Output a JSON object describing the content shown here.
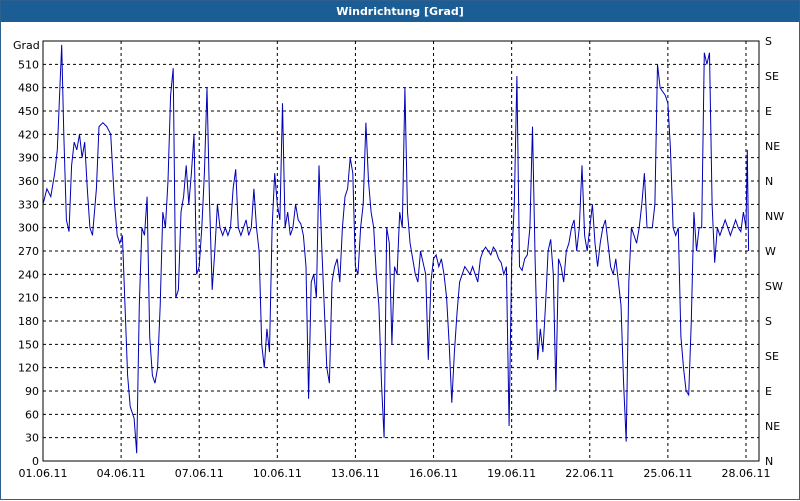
{
  "window": {
    "title": "Windrichtung [Grad]"
  },
  "colors": {
    "titlebar": "#1b5e96",
    "line": "#0000b4",
    "grid": "#000000"
  },
  "chart_data": {
    "type": "line",
    "title": "Windrichtung [Grad]",
    "ylabel": "Grad",
    "ylim": [
      0,
      540
    ],
    "yticks": [
      0,
      30,
      60,
      90,
      120,
      150,
      180,
      210,
      240,
      270,
      300,
      330,
      360,
      390,
      420,
      450,
      480,
      510
    ],
    "right_axis_labels": [
      "N",
      "NE",
      "E",
      "SE",
      "S",
      "SW",
      "W",
      "NW",
      "N",
      "NE",
      "E",
      "SE",
      "S"
    ],
    "xlabels": [
      "01.06.11",
      "04.06.11",
      "07.06.11",
      "10.06.11",
      "13.06.11",
      "16.06.11",
      "19.06.11",
      "22.06.11",
      "25.06.11",
      "28.06.11"
    ],
    "x_unit": "days since 01.06.11",
    "grid": true,
    "series": [
      {
        "color": "#0000b4",
        "points": [
          [
            0.0,
            330
          ],
          [
            0.15,
            350
          ],
          [
            0.3,
            340
          ],
          [
            0.45,
            370
          ],
          [
            0.55,
            400
          ],
          [
            0.65,
            480
          ],
          [
            0.72,
            535
          ],
          [
            0.8,
            420
          ],
          [
            0.9,
            310
          ],
          [
            1.0,
            295
          ],
          [
            1.1,
            380
          ],
          [
            1.2,
            410
          ],
          [
            1.3,
            400
          ],
          [
            1.4,
            420
          ],
          [
            1.5,
            390
          ],
          [
            1.6,
            410
          ],
          [
            1.7,
            350
          ],
          [
            1.8,
            300
          ],
          [
            1.9,
            290
          ],
          [
            2.05,
            350
          ],
          [
            2.15,
            430
          ],
          [
            2.3,
            435
          ],
          [
            2.45,
            430
          ],
          [
            2.6,
            420
          ],
          [
            2.75,
            330
          ],
          [
            2.85,
            290
          ],
          [
            2.95,
            280
          ],
          [
            3.05,
            290
          ],
          [
            3.15,
            200
          ],
          [
            3.25,
            110
          ],
          [
            3.35,
            70
          ],
          [
            3.5,
            55
          ],
          [
            3.6,
            10
          ],
          [
            3.7,
            200
          ],
          [
            3.8,
            300
          ],
          [
            3.9,
            290
          ],
          [
            4.0,
            340
          ],
          [
            4.1,
            160
          ],
          [
            4.2,
            110
          ],
          [
            4.3,
            100
          ],
          [
            4.4,
            120
          ],
          [
            4.5,
            200
          ],
          [
            4.6,
            320
          ],
          [
            4.7,
            300
          ],
          [
            4.8,
            360
          ],
          [
            4.9,
            470
          ],
          [
            5.0,
            505
          ],
          [
            5.1,
            210
          ],
          [
            5.2,
            220
          ],
          [
            5.3,
            320
          ],
          [
            5.4,
            340
          ],
          [
            5.5,
            380
          ],
          [
            5.6,
            330
          ],
          [
            5.7,
            370
          ],
          [
            5.8,
            420
          ],
          [
            5.9,
            240
          ],
          [
            6.0,
            250
          ],
          [
            6.1,
            300
          ],
          [
            6.2,
            370
          ],
          [
            6.3,
            480
          ],
          [
            6.4,
            330
          ],
          [
            6.5,
            220
          ],
          [
            6.6,
            270
          ],
          [
            6.7,
            330
          ],
          [
            6.8,
            300
          ],
          [
            6.9,
            290
          ],
          [
            7.0,
            300
          ],
          [
            7.1,
            290
          ],
          [
            7.2,
            300
          ],
          [
            7.3,
            350
          ],
          [
            7.4,
            375
          ],
          [
            7.5,
            300
          ],
          [
            7.6,
            290
          ],
          [
            7.7,
            300
          ],
          [
            7.8,
            310
          ],
          [
            7.9,
            290
          ],
          [
            8.0,
            300
          ],
          [
            8.1,
            350
          ],
          [
            8.2,
            300
          ],
          [
            8.3,
            270
          ],
          [
            8.4,
            150
          ],
          [
            8.5,
            120
          ],
          [
            8.6,
            170
          ],
          [
            8.7,
            140
          ],
          [
            8.8,
            300
          ],
          [
            8.9,
            370
          ],
          [
            9.0,
            330
          ],
          [
            9.1,
            310
          ],
          [
            9.2,
            460
          ],
          [
            9.3,
            300
          ],
          [
            9.4,
            320
          ],
          [
            9.5,
            290
          ],
          [
            9.6,
            300
          ],
          [
            9.7,
            330
          ],
          [
            9.8,
            310
          ],
          [
            9.9,
            305
          ],
          [
            10.0,
            290
          ],
          [
            10.1,
            250
          ],
          [
            10.2,
            80
          ],
          [
            10.3,
            230
          ],
          [
            10.4,
            240
          ],
          [
            10.5,
            210
          ],
          [
            10.6,
            380
          ],
          [
            10.7,
            280
          ],
          [
            10.8,
            200
          ],
          [
            10.9,
            120
          ],
          [
            11.0,
            100
          ],
          [
            11.1,
            230
          ],
          [
            11.2,
            250
          ],
          [
            11.3,
            260
          ],
          [
            11.4,
            230
          ],
          [
            11.5,
            300
          ],
          [
            11.6,
            340
          ],
          [
            11.7,
            350
          ],
          [
            11.8,
            390
          ],
          [
            11.9,
            370
          ],
          [
            12.0,
            250
          ],
          [
            12.1,
            240
          ],
          [
            12.2,
            300
          ],
          [
            12.3,
            330
          ],
          [
            12.4,
            435
          ],
          [
            12.5,
            360
          ],
          [
            12.6,
            320
          ],
          [
            12.7,
            300
          ],
          [
            12.8,
            240
          ],
          [
            12.9,
            200
          ],
          [
            13.0,
            100
          ],
          [
            13.1,
            30
          ],
          [
            13.2,
            300
          ],
          [
            13.3,
            280
          ],
          [
            13.4,
            150
          ],
          [
            13.5,
            250
          ],
          [
            13.6,
            240
          ],
          [
            13.7,
            320
          ],
          [
            13.8,
            300
          ],
          [
            13.9,
            480
          ],
          [
            14.0,
            320
          ],
          [
            14.1,
            280
          ],
          [
            14.2,
            260
          ],
          [
            14.3,
            240
          ],
          [
            14.4,
            230
          ],
          [
            14.5,
            270
          ],
          [
            14.6,
            255
          ],
          [
            14.7,
            240
          ],
          [
            14.8,
            130
          ],
          [
            14.9,
            230
          ],
          [
            15.0,
            260
          ],
          [
            15.1,
            265
          ],
          [
            15.2,
            250
          ],
          [
            15.3,
            260
          ],
          [
            15.4,
            240
          ],
          [
            15.5,
            210
          ],
          [
            15.6,
            150
          ],
          [
            15.7,
            75
          ],
          [
            15.8,
            140
          ],
          [
            15.9,
            190
          ],
          [
            16.0,
            230
          ],
          [
            16.1,
            240
          ],
          [
            16.2,
            250
          ],
          [
            16.3,
            245
          ],
          [
            16.4,
            240
          ],
          [
            16.5,
            250
          ],
          [
            16.6,
            240
          ],
          [
            16.7,
            230
          ],
          [
            16.8,
            260
          ],
          [
            16.9,
            270
          ],
          [
            17.0,
            275
          ],
          [
            17.1,
            270
          ],
          [
            17.2,
            265
          ],
          [
            17.3,
            275
          ],
          [
            17.4,
            270
          ],
          [
            17.5,
            260
          ],
          [
            17.6,
            255
          ],
          [
            17.7,
            240
          ],
          [
            17.8,
            250
          ],
          [
            17.9,
            45
          ],
          [
            18.0,
            260
          ],
          [
            18.1,
            330
          ],
          [
            18.2,
            495
          ],
          [
            18.3,
            250
          ],
          [
            18.4,
            245
          ],
          [
            18.5,
            260
          ],
          [
            18.6,
            265
          ],
          [
            18.7,
            300
          ],
          [
            18.8,
            430
          ],
          [
            18.9,
            260
          ],
          [
            19.0,
            130
          ],
          [
            19.1,
            170
          ],
          [
            19.2,
            140
          ],
          [
            19.3,
            200
          ],
          [
            19.4,
            270
          ],
          [
            19.5,
            285
          ],
          [
            19.6,
            240
          ],
          [
            19.7,
            90
          ],
          [
            19.8,
            260
          ],
          [
            19.9,
            250
          ],
          [
            20.0,
            230
          ],
          [
            20.1,
            270
          ],
          [
            20.2,
            280
          ],
          [
            20.3,
            300
          ],
          [
            20.4,
            310
          ],
          [
            20.5,
            270
          ],
          [
            20.6,
            300
          ],
          [
            20.7,
            380
          ],
          [
            20.8,
            290
          ],
          [
            20.9,
            270
          ],
          [
            21.0,
            300
          ],
          [
            21.1,
            330
          ],
          [
            21.2,
            280
          ],
          [
            21.3,
            250
          ],
          [
            21.4,
            280
          ],
          [
            21.5,
            300
          ],
          [
            21.6,
            310
          ],
          [
            21.7,
            280
          ],
          [
            21.8,
            250
          ],
          [
            21.9,
            240
          ],
          [
            22.0,
            260
          ],
          [
            22.1,
            230
          ],
          [
            22.2,
            200
          ],
          [
            22.3,
            100
          ],
          [
            22.4,
            25
          ],
          [
            22.5,
            230
          ],
          [
            22.6,
            300
          ],
          [
            22.7,
            290
          ],
          [
            22.8,
            280
          ],
          [
            22.9,
            300
          ],
          [
            23.0,
            330
          ],
          [
            23.1,
            370
          ],
          [
            23.2,
            300
          ],
          [
            23.3,
            300
          ],
          [
            23.4,
            300
          ],
          [
            23.5,
            330
          ],
          [
            23.6,
            510
          ],
          [
            23.7,
            480
          ],
          [
            23.8,
            475
          ],
          [
            23.9,
            470
          ],
          [
            24.0,
            460
          ],
          [
            24.1,
            400
          ],
          [
            24.2,
            300
          ],
          [
            24.3,
            290
          ],
          [
            24.4,
            300
          ],
          [
            24.5,
            160
          ],
          [
            24.6,
            120
          ],
          [
            24.7,
            90
          ],
          [
            24.8,
            85
          ],
          [
            24.9,
            180
          ],
          [
            25.0,
            320
          ],
          [
            25.1,
            270
          ],
          [
            25.2,
            300
          ],
          [
            25.3,
            300
          ],
          [
            25.4,
            525
          ],
          [
            25.5,
            510
          ],
          [
            25.6,
            525
          ],
          [
            25.7,
            330
          ],
          [
            25.8,
            255
          ],
          [
            25.9,
            300
          ],
          [
            26.0,
            290
          ],
          [
            26.1,
            300
          ],
          [
            26.2,
            310
          ],
          [
            26.3,
            300
          ],
          [
            26.4,
            290
          ],
          [
            26.5,
            300
          ],
          [
            26.6,
            310
          ],
          [
            26.7,
            300
          ],
          [
            26.8,
            295
          ],
          [
            26.9,
            320
          ],
          [
            27.0,
            300
          ],
          [
            27.05,
            400
          ],
          [
            27.1,
            270
          ]
        ]
      }
    ]
  }
}
